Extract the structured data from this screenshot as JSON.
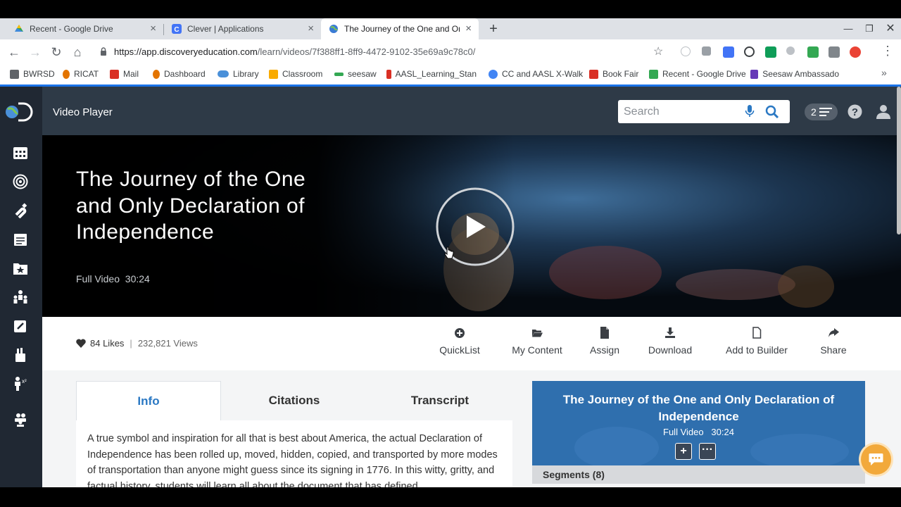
{
  "browser": {
    "tabs": [
      {
        "title": "Recent - Google Drive",
        "icon": "google-drive-icon",
        "active": false
      },
      {
        "title": "Clever | Applications",
        "icon": "clever-icon",
        "active": false
      },
      {
        "title": "The Journey of the One and Only",
        "icon": "discovery-globe-icon",
        "active": true
      }
    ],
    "url_host": "https://app.discoveryeducation.com",
    "url_path": "/learn/videos/7f388ff1-8ff9-4472-9102-35e69a9c78c0/",
    "bookmarks": [
      {
        "label": "BWRSD",
        "icon": "folder-icon",
        "color": "#5f6368"
      },
      {
        "label": "RICAT",
        "icon": "ricat-icon",
        "color": "#e37400"
      },
      {
        "label": "Mail",
        "icon": "gmail-icon",
        "color": "#d93025"
      },
      {
        "label": "Dashboard",
        "icon": "dashboard-icon",
        "color": "#e37400"
      },
      {
        "label": "Library",
        "icon": "cloud-icon",
        "color": "#4a90d9"
      },
      {
        "label": "Classroom",
        "icon": "classroom-icon",
        "color": "#f9ab00"
      },
      {
        "label": "seesaw",
        "icon": "seesaw-icon",
        "color": "#34a853"
      },
      {
        "label": "AASL_Learning_Stan",
        "icon": "aasl-icon",
        "color": "#d93025"
      },
      {
        "label": "CC and AASL X-Walk",
        "icon": "google-icon",
        "color": "#4285f4"
      },
      {
        "label": "Book Fair",
        "icon": "scholastic-icon",
        "color": "#d93025"
      },
      {
        "label": "Recent - Google Drive",
        "icon": "google-drive-icon",
        "color": "#34a853"
      },
      {
        "label": "Seesaw Ambassado",
        "icon": "forms-icon",
        "color": "#673ab7"
      }
    ]
  },
  "app": {
    "header_title": "Video Player",
    "search_placeholder": "Search",
    "list_count": "2"
  },
  "video": {
    "title": "The Journey of the One and Only Declaration of Independence",
    "type_label": "Full Video",
    "duration": "30:24",
    "likes": "84 Likes",
    "views": "232,821 Views"
  },
  "actions": [
    {
      "label": "QuickList",
      "icon": "plus-circle-icon"
    },
    {
      "label": "My Content",
      "icon": "folder-open-icon"
    },
    {
      "label": "Assign",
      "icon": "document-icon"
    },
    {
      "label": "Download",
      "icon": "download-icon"
    },
    {
      "label": "Add to Builder",
      "icon": "file-outline-icon"
    },
    {
      "label": "Share",
      "icon": "share-icon"
    }
  ],
  "content_tabs": [
    {
      "label": "Info",
      "active": true
    },
    {
      "label": "Citations",
      "active": false
    },
    {
      "label": "Transcript",
      "active": false
    }
  ],
  "info_text": "A true symbol and inspiration for all that is best about America, the actual Declaration of Independence has been rolled up, moved, hidden, copied, and transported by more modes of transportation than anyone might guess since its signing in 1776. In this witty, gritty, and factual history, students will learn all about the document that has defined",
  "card": {
    "title": "The Journey of the One and Only Declaration of Independence",
    "meta": "Full Video   30:24",
    "segments_label": "Segments (8)"
  },
  "colors": {
    "sidebar": "#202833",
    "header": "#2e3a47",
    "accent_blue": "#2a78c3",
    "card_blue": "#2f6fae",
    "chat_orange": "#f2a93b"
  }
}
